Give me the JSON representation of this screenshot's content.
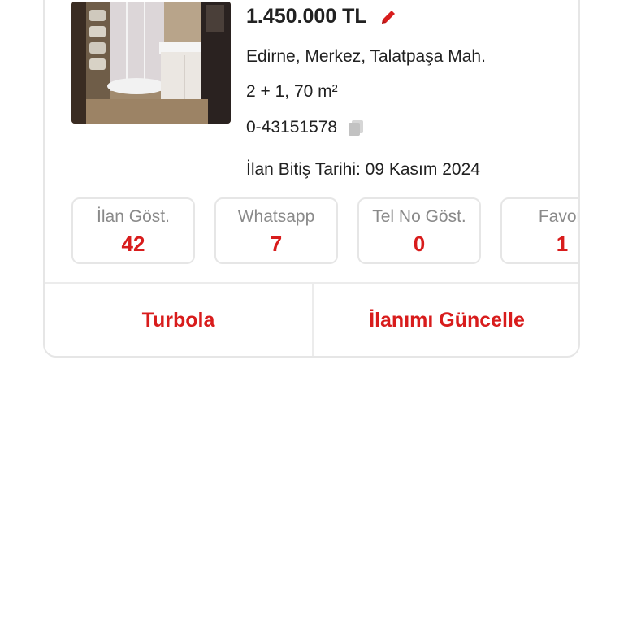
{
  "listing": {
    "price": "1.450.000 TL",
    "location": "Edirne, Merkez, Talatpaşa Mah.",
    "rooms_area": "2 + 1, 70 m²",
    "listing_id": "0-43151578",
    "end_date": "İlan Bitiş Tarihi: 09 Kasım 2024",
    "photo_icon": "bathroom-photo",
    "edit_icon": "pencil-icon",
    "copy_icon": "copy-icon"
  },
  "stats": [
    {
      "label": "İlan Göst.",
      "value": "42"
    },
    {
      "label": "Whatsapp",
      "value": "7"
    },
    {
      "label": "Tel No Göst.",
      "value": "0"
    },
    {
      "label": "Favori",
      "value": "1"
    }
  ],
  "actions": {
    "turbo": "Turbola",
    "update": "İlanımı Güncelle"
  },
  "colors": {
    "accent": "#d81c1c",
    "border": "#e6e6e6",
    "muted": "#8a8a8a"
  }
}
